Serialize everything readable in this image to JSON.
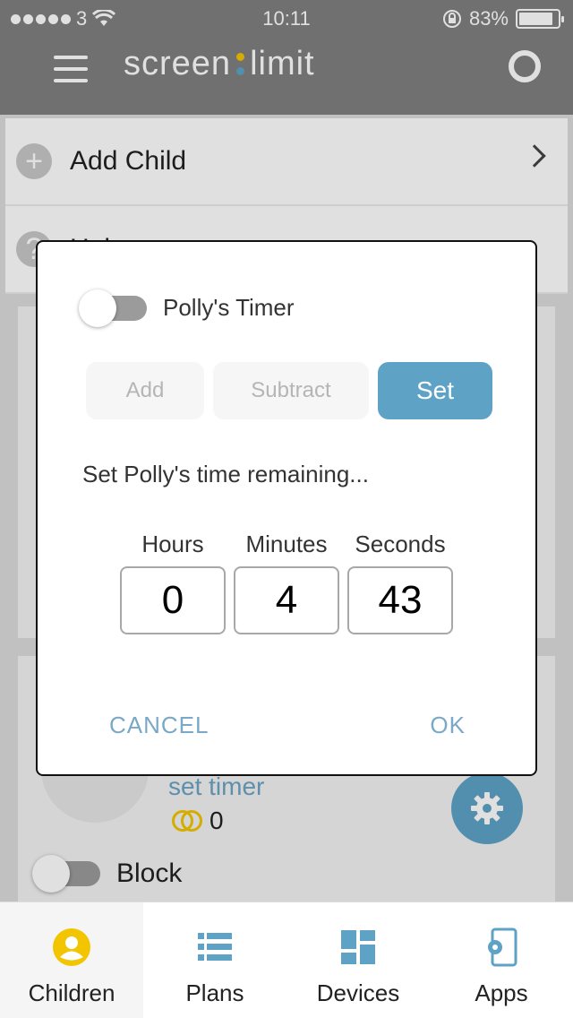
{
  "status_bar": {
    "carrier": "3",
    "time": "10:11",
    "battery": "83%"
  },
  "header": {
    "brand_left": "screen",
    "brand_right": "limit",
    "colon_colors": [
      "#f2c500",
      "#5ea3c6"
    ]
  },
  "list": {
    "add_child": "Add Child",
    "help": "Help"
  },
  "child_card": {
    "timer_link": "set timer",
    "coins": "0",
    "block_label": "Block"
  },
  "tabs": [
    {
      "label": "Children",
      "icon": "child-icon",
      "active": true
    },
    {
      "label": "Plans",
      "icon": "list-icon",
      "active": false
    },
    {
      "label": "Devices",
      "icon": "devices-icon",
      "active": false
    },
    {
      "label": "Apps",
      "icon": "apps-phone-gear-icon",
      "active": false
    }
  ],
  "modal": {
    "title": "Polly's Timer",
    "buttons": {
      "add": "Add",
      "subtract": "Subtract",
      "set": "Set"
    },
    "prompt": "Set Polly's time remaining...",
    "fields": {
      "hours_label": "Hours",
      "hours_value": "0",
      "minutes_label": "Minutes",
      "minutes_value": "4",
      "seconds_label": "Seconds",
      "seconds_value": "43"
    },
    "cancel": "CANCEL",
    "ok": "OK"
  },
  "colors": {
    "accent": "#5ea3c6",
    "header_gray": "#808080",
    "coin": "#f2c500",
    "link": "#7aa9c8"
  }
}
